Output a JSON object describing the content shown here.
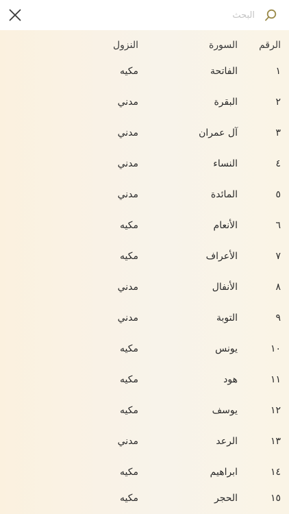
{
  "search": {
    "placeholder": "البحث"
  },
  "table": {
    "headers": {
      "number": "الرقم",
      "surah": "السورة",
      "revelation": "النزول"
    },
    "rows": [
      {
        "number": "١",
        "surah": "الفاتحة",
        "revelation": "مكيه"
      },
      {
        "number": "٢",
        "surah": "البقرة",
        "revelation": "مدني"
      },
      {
        "number": "٣",
        "surah": "آل عمران",
        "revelation": "مدني"
      },
      {
        "number": "٤",
        "surah": "النساء",
        "revelation": "مدني"
      },
      {
        "number": "٥",
        "surah": "المائدة",
        "revelation": "مدني"
      },
      {
        "number": "٦",
        "surah": "الأنعام",
        "revelation": "مكيه"
      },
      {
        "number": "٧",
        "surah": "الأعراف",
        "revelation": "مكيه"
      },
      {
        "number": "٨",
        "surah": "الأنفال",
        "revelation": "مدني"
      },
      {
        "number": "٩",
        "surah": "التوبة",
        "revelation": "مدني"
      },
      {
        "number": "١٠",
        "surah": "يونس",
        "revelation": "مكيه"
      },
      {
        "number": "١١",
        "surah": "هود",
        "revelation": "مكيه"
      },
      {
        "number": "١٢",
        "surah": "يوسف",
        "revelation": "مكيه"
      },
      {
        "number": "١٣",
        "surah": "الرعد",
        "revelation": "مدني"
      },
      {
        "number": "١٤",
        "surah": "ابراهيم",
        "revelation": "مكيه"
      },
      {
        "number": "١٥",
        "surah": "الحجر",
        "revelation": "مكيه"
      }
    ]
  },
  "colors": {
    "accent": "#9a8a4a",
    "text": "#2b2b2b",
    "panel": "#f8f3ea"
  },
  "icons": {
    "close": "close-icon",
    "search": "search-icon"
  }
}
